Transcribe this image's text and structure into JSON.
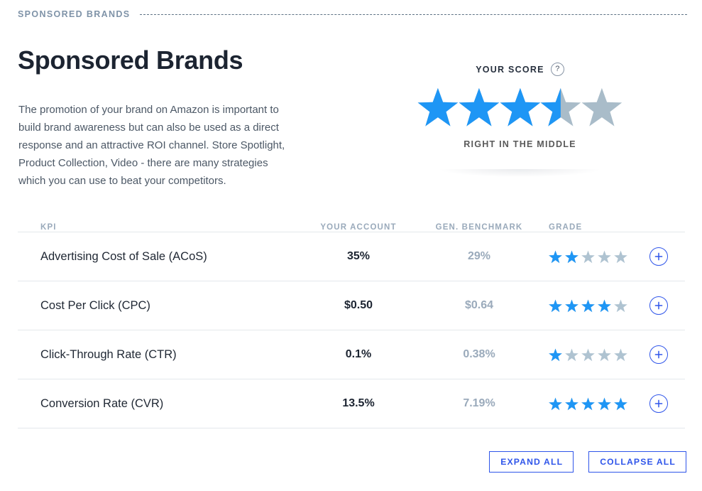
{
  "eyebrow": {
    "label": "SPONSORED BRANDS"
  },
  "header": {
    "title": "Sponsored Brands",
    "description": "The promotion of your brand on Amazon is important to build brand awareness but can also be used as a direct response and an attractive ROI channel. Store Spotlight, Product Collection, Video - there are many strategies which you can use to beat your competitors."
  },
  "score": {
    "label": "YOUR SCORE",
    "help_icon": "question-mark-icon",
    "stars_filled": 3.5,
    "stars_total": 5,
    "caption": "RIGHT IN THE MIDDLE",
    "filled_color": "#1E96F5",
    "empty_color": "#A9BCC9"
  },
  "table": {
    "columns": [
      "KPI",
      "YOUR ACCOUNT",
      "GEN. BENCHMARK",
      "GRADE",
      ""
    ],
    "grade_filled_color": "#1E96F5",
    "grade_empty_color": "#AFC3D1",
    "rows": [
      {
        "kpi": "Advertising Cost of Sale (ACoS)",
        "your_account": "35%",
        "benchmark": "29%",
        "grade": 2,
        "grade_total": 5,
        "action_icon": "plus-icon"
      },
      {
        "kpi": "Cost Per Click (CPC)",
        "your_account": "$0.50",
        "benchmark": "$0.64",
        "grade": 4,
        "grade_total": 5,
        "action_icon": "plus-icon"
      },
      {
        "kpi": "Click-Through Rate (CTR)",
        "your_account": "0.1%",
        "benchmark": "0.38%",
        "grade": 1,
        "grade_total": 5,
        "action_icon": "plus-icon"
      },
      {
        "kpi": "Conversion Rate (CVR)",
        "your_account": "13.5%",
        "benchmark": "7.19%",
        "grade": 5,
        "grade_total": 5,
        "action_icon": "plus-icon"
      }
    ]
  },
  "footer": {
    "expand_all": "EXPAND ALL",
    "collapse_all": "COLLAPSE ALL",
    "accent_color": "#2F55EA"
  }
}
